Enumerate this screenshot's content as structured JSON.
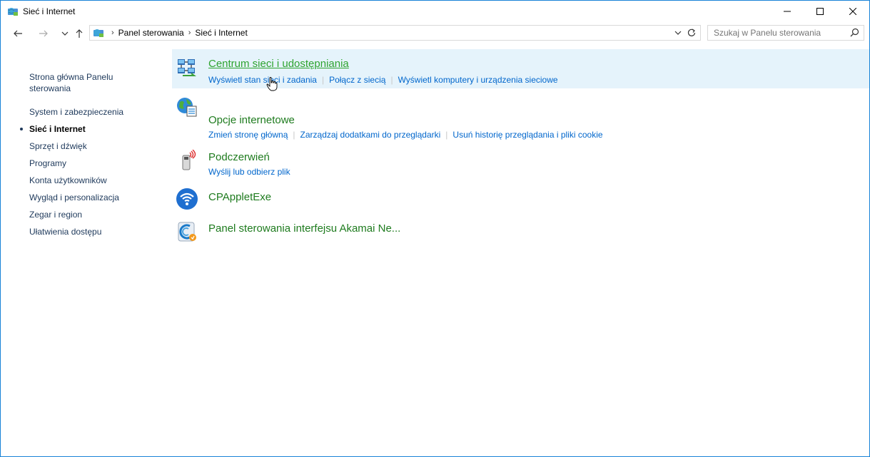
{
  "window": {
    "title": "Sieć i Internet",
    "icon": "network-globe-icon"
  },
  "address": {
    "breadcrumbs": [
      "Panel sterowania",
      "Sieć i Internet"
    ],
    "search_placeholder": "Szukaj w Panelu sterowania"
  },
  "leftnav": {
    "home": "Strona główna Panelu sterowania",
    "items": [
      "System i zabezpieczenia",
      "Sieć i Internet",
      "Sprzęt i dźwięk",
      "Programy",
      "Konta użytkowników",
      "Wygląd i personalizacja",
      "Zegar i region",
      "Ułatwienia dostępu"
    ],
    "current_index": 1
  },
  "categories": [
    {
      "title": "Centrum sieci i udostępniania",
      "icon": "network-center-icon",
      "links": [
        "Wyświetl stan sieci i zadania",
        "Połącz z siecią",
        "Wyświetl komputery i urządzenia sieciowe"
      ]
    },
    {
      "title": "Opcje internetowe",
      "icon": "internet-options-icon",
      "links": [
        "Zmień stronę główną",
        "Zarządzaj dodatkami do przeglądarki",
        "Usuń historię przeglądania i pliki cookie"
      ]
    },
    {
      "title": "Podczerwień",
      "icon": "infrared-icon",
      "links": [
        "Wyślij lub odbierz plik"
      ]
    },
    {
      "title": "CPAppletExe",
      "icon": "wifi-applet-icon",
      "links": []
    },
    {
      "title": "Panel sterowania interfejsu Akamai Ne...",
      "icon": "akamai-icon",
      "links": []
    }
  ],
  "colors": {
    "category_title": "#1e7b1e",
    "category_title_hover": "#2fa42f",
    "link": "#0066cc",
    "hover_bg": "#e5f3fb",
    "window_border": "#1883d7"
  }
}
